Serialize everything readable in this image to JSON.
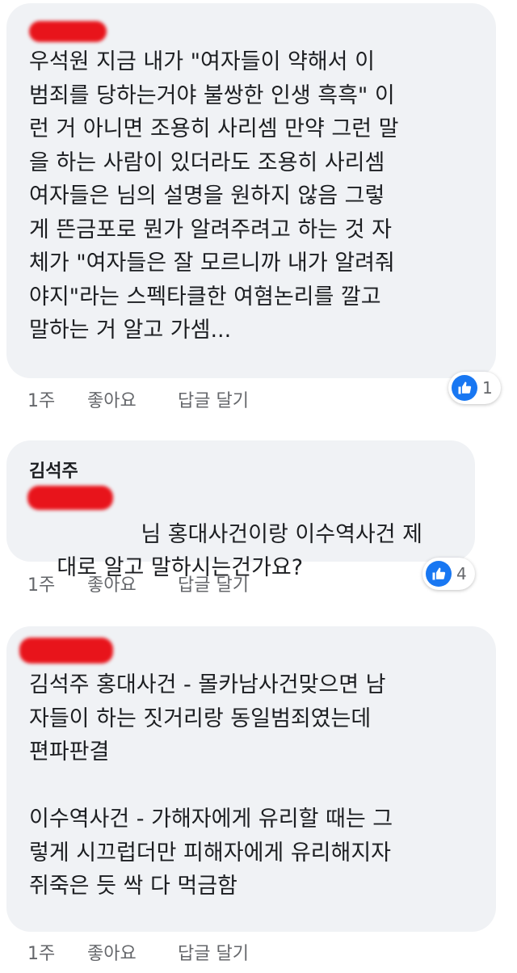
{
  "comments": [
    {
      "author": "",
      "text": "우석원 지금 내가 \"여자들이 약해서 이\n범죄를 당하는거야 불쌍한 인생 흑흑\" 이\n런 거 아니면 조용히 사리셈 만약 그런 말\n을 하는 사람이 있더라도 조용히 사리셈\n여자들은 님의 설명을 원하지 않음 그렇\n게 뜬금포로 뭔가 알려주려고 하는 것 자\n체가 \"여자들은 잘 모르니까 내가 알려줘\n야지\"라는 스펙타클한 여혐논리를 깔고\n말하는 거 알고 가셈...",
      "time": "1주",
      "like_label": "좋아요",
      "reply_label": "답글 달기",
      "reaction_count": "1"
    },
    {
      "author": "김석주",
      "text_after_mention": "님 홍대사건이랑 이수역사건 제",
      "text_line2": "대로 알고 말하시는건가요?",
      "time": "1주",
      "like_label": "좋아요",
      "reply_label": "답글 달기",
      "reaction_count": "4"
    },
    {
      "author": "",
      "text": "김석주 홍대사건 - 몰카남사건맞으면 남\n자들이 하는 짓거리랑 동일범죄였는데\n편파판결\n\n이수역사건 - 가해자에게 유리할 때는 그\n렇게 시끄럽더만 피해자에게 유리해지자\n쥐죽은 듯 싹 다 먹금함",
      "time": "1주",
      "like_label": "좋아요",
      "reply_label": "답글 달기"
    }
  ],
  "colors": {
    "bubble": "#f0f2f5",
    "text": "#1c1e21",
    "meta": "#65676b",
    "like": "#1877f2",
    "redaction": "#e8141b"
  },
  "icons": {
    "reaction": "thumbs-up-icon"
  }
}
